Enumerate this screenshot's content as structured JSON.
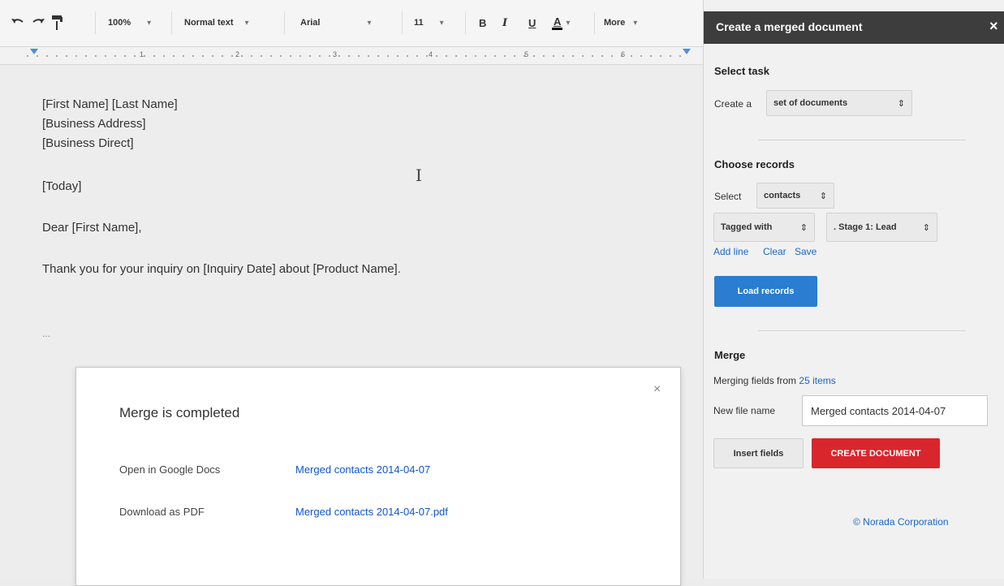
{
  "toolbar": {
    "undo_icon": "undo-icon",
    "redo_icon": "redo-icon",
    "paint_format_icon": "paint-format-icon",
    "zoom": "100%",
    "style": "Normal text",
    "font": "Arial",
    "font_size": "11",
    "bold": "B",
    "italic": "I",
    "underline": "U",
    "text_color": "A",
    "more": "More"
  },
  "ruler": {
    "numbers": [
      "1",
      "2",
      "3",
      "4",
      "5",
      "6"
    ]
  },
  "document": {
    "lines": [
      "[First Name] [Last Name]",
      "[Business Address]",
      "[Business Direct]",
      "[Today]",
      "Dear [First Name],",
      "Thank you for your inquiry on [Inquiry Date] about [Product Name].",
      "..."
    ]
  },
  "dialog": {
    "title": "Merge is completed",
    "close": "×",
    "rows": [
      {
        "label": "Open in Google Docs",
        "link": "Merged contacts 2014-04-07"
      },
      {
        "label": "Download as PDF",
        "link": "Merged contacts 2014-04-07.pdf"
      }
    ]
  },
  "sidebar": {
    "title": "Create a merged document",
    "close": "×",
    "select_task": {
      "heading": "Select task",
      "label": "Create a",
      "value": "set of documents"
    },
    "choose_records": {
      "heading": "Choose records",
      "label": "Select",
      "value": "contacts",
      "filter_field": "Tagged with",
      "filter_value": ". Stage 1: Lead",
      "link_add": "Add line",
      "link_clear": "Clear",
      "link_save": "Save",
      "load_button": "Load records"
    },
    "merge": {
      "heading": "Merge",
      "fields_text": "Merging fields from",
      "items_link": "25 items",
      "filename_label": "New file name",
      "filename_value": "Merged contacts 2014-04-07",
      "insert_button": "Insert fields",
      "create_button": "CREATE DOCUMENT"
    },
    "copyright": "© Norada Corporation"
  },
  "colors": {
    "accent_blue": "#2a7dd0",
    "create_red": "#d9262c",
    "header_dark": "#3d3d3d",
    "link_blue": "#1155cc"
  }
}
